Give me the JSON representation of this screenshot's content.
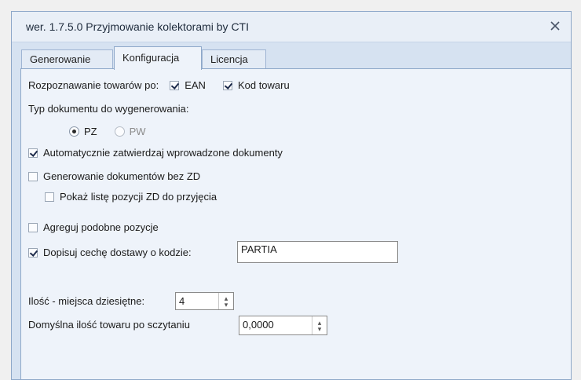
{
  "window": {
    "title": "wer. 1.7.5.0 Przyjmowanie kolektorami by CTI",
    "close_icon": "close-icon"
  },
  "tabs": [
    {
      "label": "Generowanie"
    },
    {
      "label": "Konfiguracja"
    },
    {
      "label": "Licencja"
    }
  ],
  "config": {
    "recognize_label": "Rozpoznawanie towarów po:",
    "ean_label": "EAN",
    "kod_label": "Kod towaru",
    "doc_type_label": "Typ dokumentu do wygenerowania:",
    "pz_label": "PZ",
    "pw_label": "PW",
    "auto_approve_label": "Automatycznie zatwierdzaj wprowadzone dokumenty",
    "gen_without_zd_label": "Generowanie dokumentów bez ZD",
    "show_zd_list_label": "Pokaż listę pozycji ZD do przyjęcia",
    "aggregate_label": "Agreguj podobne pozycje",
    "append_feature_label": "Dopisuj cechę dostawy o kodzie:",
    "append_feature_value": "PARTIA",
    "decimals_label": "Ilość - miejsca dziesiętne:",
    "decimals_value": "4",
    "default_qty_label": "Domyślna ilość towaru po sczytaniu",
    "default_qty_value": "0,0000"
  },
  "colors": {
    "accent": "#8ea8c9",
    "panel": "#eef3fa",
    "frame": "#d6e2f1"
  }
}
